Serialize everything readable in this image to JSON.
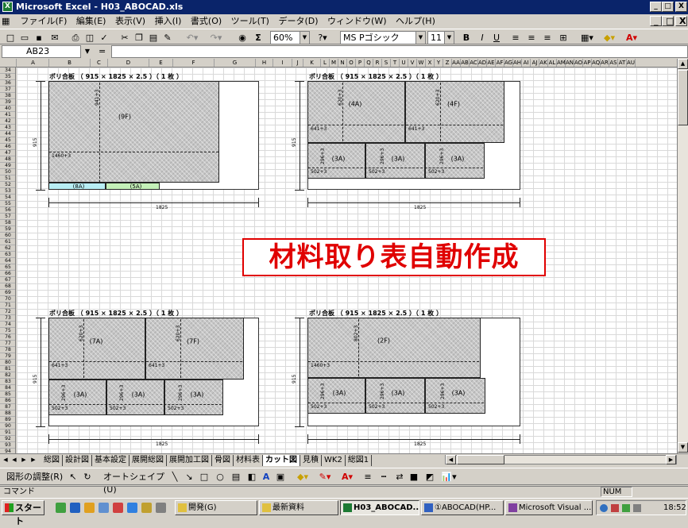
{
  "window": {
    "title": "Microsoft Excel - H03_ABOCAD.xls",
    "controls": [
      "_",
      "□",
      "X"
    ]
  },
  "doc_controls": [
    "_",
    "□",
    "X"
  ],
  "menu": [
    "ファイル(F)",
    "編集(E)",
    "表示(V)",
    "挿入(I)",
    "書式(O)",
    "ツール(T)",
    "データ(D)",
    "ウィンドウ(W)",
    "ヘルプ(H)"
  ],
  "toolbar": {
    "zoom": "60%",
    "font": "MS Pゴシック",
    "size": "11",
    "bold": "B",
    "italic": "I",
    "underline": "U",
    "sum": "Σ"
  },
  "namebox": "AB23",
  "formula_eq": "=",
  "columns": [
    "A",
    "B",
    "C",
    "D",
    "E",
    "F",
    "G",
    "H",
    "I",
    "J",
    "K",
    "L",
    "M",
    "N",
    "O",
    "P",
    "Q",
    "R",
    "S",
    "T",
    "U",
    "V",
    "W",
    "X",
    "Y",
    "Z",
    "AA",
    "AB",
    "AC",
    "AD",
    "AE",
    "AF",
    "AG",
    "AH",
    "AI",
    "AJ",
    "AK",
    "AL",
    "AM",
    "AN",
    "AO",
    "AP",
    "AQ",
    "AR",
    "AS",
    "AT",
    "AU"
  ],
  "rows": [
    "34",
    "35",
    "36",
    "37",
    "38",
    "39",
    "40",
    "41",
    "42",
    "43",
    "44",
    "45",
    "46",
    "47",
    "48",
    "49",
    "50",
    "51",
    "52",
    "53",
    "54",
    "55",
    "56",
    "57",
    "58",
    "59",
    "60",
    "61",
    "62",
    "63",
    "64",
    "65",
    "66",
    "67",
    "68",
    "69",
    "70",
    "71",
    "72",
    "73",
    "74",
    "75",
    "76",
    "77",
    "78",
    "79",
    "80",
    "81",
    "82",
    "83",
    "84",
    "85",
    "86",
    "87",
    "88",
    "89",
    "90",
    "91",
    "92",
    "93",
    "94",
    "95"
  ],
  "panel_title": "ポリ合板 （ 915 × 1825 × 2.5 ）（ 1 枚 ）",
  "dim_width": "1825",
  "dim_height": "915",
  "banner": "材料取り表自動作成",
  "panel1": {
    "big": "(9F)",
    "dim_v": "941+3",
    "dim_h": "1460+3",
    "strip_left": "(8A)",
    "strip_right": "(5A)"
  },
  "panel2": {
    "a": "(4A)",
    "b": "(4F)",
    "dim_v": "620+3",
    "dim_h": "641+3",
    "small": [
      "(3A)",
      "(3A)",
      "(3A)"
    ],
    "small_v": "296+3",
    "small_h": "502+3"
  },
  "panel3": {
    "a": "(7A)",
    "b": "(7F)",
    "dim_v": "620+3",
    "dim_h": "641+3",
    "small": [
      "(3A)",
      "(3A)",
      "(3A)"
    ],
    "small_v": "296+3",
    "small_h": "502+3"
  },
  "panel4": {
    "big": "(2F)",
    "dim_v": "802+3",
    "dim_h": "1460+3",
    "small": [
      "(3A)",
      "(3A)",
      "(3A)"
    ],
    "small_v": "296+3",
    "small_h": "502+3"
  },
  "sheet_tabs": [
    "総図",
    "設計図",
    "基本設定",
    "展開総図",
    "展開加工図",
    "骨図",
    "材料表",
    "カット図",
    "見積",
    "WK2",
    "総図1"
  ],
  "active_tab": "カット図",
  "drawbar": {
    "draw": "図形の調整(R)",
    "autoshape": "オートシェイプ(U)"
  },
  "status": {
    "left": "コマンド",
    "num": "NUM"
  },
  "taskbar": {
    "start": "スタート",
    "tasks": [
      "開発(G)",
      "最新資料",
      "H03_ABOCAD...",
      "①ABOCAD(HP...",
      "Microsoft Visual ..."
    ],
    "clock": "18:52"
  },
  "colors": {
    "title_bg": "#0a246a",
    "banner_red": "#e00000",
    "piece_fill": "#c6c6c6",
    "strip_cyan": "#b8eef4",
    "strip_green": "#c4f0b8"
  }
}
